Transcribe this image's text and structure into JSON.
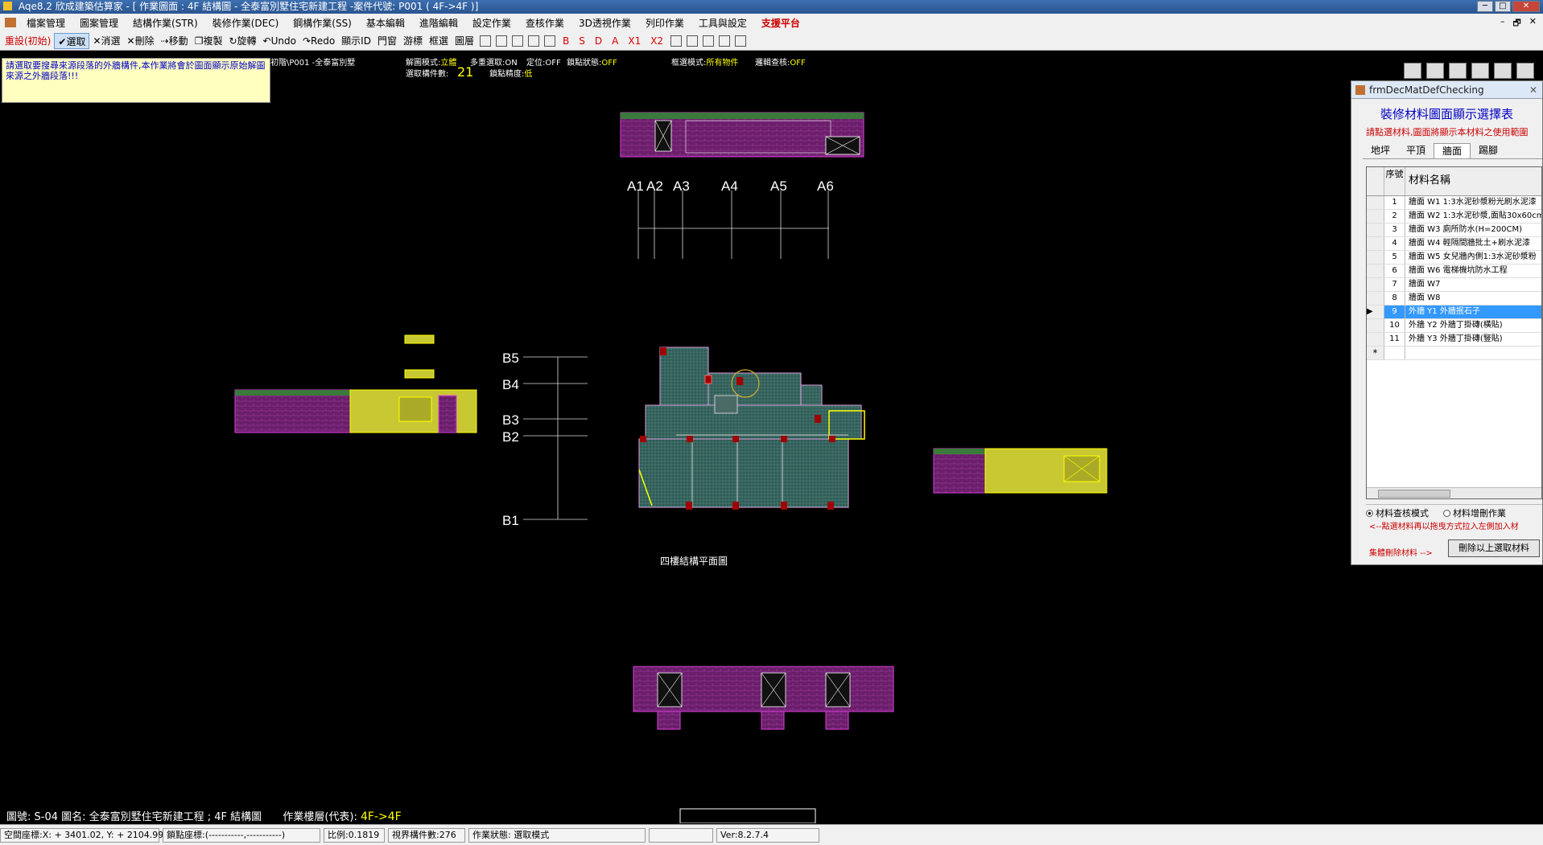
{
  "window": {
    "title": "Aqe8.2 欣成建築估算家 - [ 作業圖面 : 4F  結構圖 - 全泰富別墅住宅新建工程 -案件代號: P001 ( 4F->4F )]",
    "minimize": "─",
    "maximize": "□",
    "close": "✕"
  },
  "menu": {
    "items": [
      "檔案管理",
      "圖案管理",
      "結構作業(STR)",
      "裝修作業(DEC)",
      "鋼構作業(SS)",
      "基本編輯",
      "進階編輯",
      "設定作業",
      "查核作業",
      "3D透視作業",
      "列印作業",
      "工具與設定"
    ],
    "support": "支援平台",
    "mdi_min": "–",
    "mdi_restore": "🗗",
    "mdi_close": "✕"
  },
  "toolbar": {
    "reset": "重設(初始)",
    "select": "選取",
    "cancel": "消選",
    "delete": "刪除",
    "move": "移動",
    "copy": "複製",
    "rotate": "旋轉",
    "undo": "Undo",
    "redo": "Redo",
    "showid": "顯示ID",
    "doorwin": "門窗",
    "cursor": "游標",
    "box": "框選",
    "layer": "圖層",
    "letters": [
      "B",
      "S",
      "D",
      "A",
      "X1",
      "X2"
    ]
  },
  "hint": "請選取要搜尋來源段落的外牆構件,本作業將會於圖面顯示原始解圖來源之外牆段落!!!",
  "info": {
    "path": "初階\\P001 -全泰富別墅",
    "parse_mode_label": "解圖模式:",
    "parse_mode": "立體",
    "multi_select": "多重選取:ON",
    "position": "定位:OFF",
    "snap_state_label": "鎖點狀態:",
    "snap_state": "OFF",
    "box_mode_label": "框選模式:",
    "box_mode": "所有物件",
    "chain_check_label": "邏輯查核:",
    "chain_check": "OFF",
    "selected_count_label": "選取構件數:",
    "selected_count": "21",
    "snap_precision_label": "鎖點精度:",
    "snap_precision": "低"
  },
  "drawing": {
    "grid_x": [
      "A1",
      "A2",
      "A3",
      "A4",
      "A5",
      "A6"
    ],
    "grid_y": [
      "B5",
      "B4",
      "B3",
      "B2",
      "B1"
    ],
    "plan_title": "四樓結構平面圖"
  },
  "bottom": {
    "sheet": "圖號: S-04  圖名: 全泰富別墅住宅新建工程 ; 4F  結構圖",
    "floor_label": "作業樓層(代表):",
    "floor": "4F->4F"
  },
  "status": {
    "coord": "空間座標:X: + 3401.02, Y: + 2104.998",
    "snap": "鎖點座標:(-----------,-----------)",
    "scale": "比例:0.1819",
    "visible": "視界構件數:276",
    "state": "作業狀態: 選取模式",
    "blank": "",
    "version": "Ver:8.2.7.4"
  },
  "panel": {
    "title": "frmDecMatDefChecking",
    "close": "✕",
    "heading": "裝修材料圖面顯示選擇表",
    "sub": "請點選材料,圖面將顯示本材料之使用範圍",
    "tabs": [
      "地坪",
      "平頂",
      "牆面",
      "踢腳"
    ],
    "col_no": "序號",
    "col_name": "材料名稱",
    "rows": [
      {
        "no": "1",
        "name": "牆面 W1  1:3水泥砂漿粉光刷水泥漆"
      },
      {
        "no": "2",
        "name": "牆面 W2  1:3水泥砂漿,面貼30x60cm"
      },
      {
        "no": "3",
        "name": "牆面 W3  廁所防水(H=200CM)"
      },
      {
        "no": "4",
        "name": "牆面 W4  輕隔間牆批土+刷水泥漆"
      },
      {
        "no": "5",
        "name": "牆面 W5  女兒牆內側1:3水泥砂漿粉"
      },
      {
        "no": "6",
        "name": "牆面 W6  電梯機坑防水工程"
      },
      {
        "no": "7",
        "name": "牆面 W7"
      },
      {
        "no": "8",
        "name": "牆面 W8"
      },
      {
        "no": "9",
        "name": "外牆 Y1  外牆抿石子"
      },
      {
        "no": "10",
        "name": "外牆 Y2  外牆丁掛磚(橫貼)"
      },
      {
        "no": "11",
        "name": "外牆 Y3  外牆丁掛磚(豎貼)"
      }
    ],
    "new_row": "*",
    "radio_check": "材料查核模式",
    "radio_add": "材料增刪作業",
    "note": "<--點選材料再以拖曳方式拉入左側加入材",
    "batch_delete": "集體刪除材料 -->",
    "delete_button": "刪除以上選取材料"
  },
  "colors": {
    "brick": "#6a1e6a",
    "yellow": "#c8c832",
    "teal": "#2d5a55",
    "selected": "#3399ff"
  }
}
